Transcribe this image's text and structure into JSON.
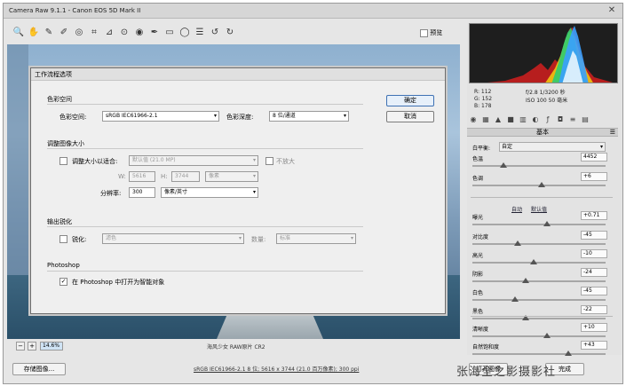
{
  "app": {
    "title": "Camera Raw 9.1.1 - Canon EOS 5D Mark II"
  },
  "toolbar": {
    "tools": [
      "zoom-icon",
      "hand-icon",
      "eyedropper-icon",
      "color-sampler-icon",
      "target-adjust-icon",
      "crop-icon",
      "straighten-icon",
      "spot-removal-icon",
      "red-eye-icon",
      "adjustment-brush-icon",
      "graduated-filter-icon",
      "radial-filter-icon",
      "preferences-icon",
      "rotate-left-icon",
      "rotate-right-icon"
    ],
    "preview_label": "预览"
  },
  "status": {
    "zoom": "14.6%",
    "filename": "海风少女 RAW原片 CR2"
  },
  "bottom": {
    "save_label": "存储图像...",
    "workflow_link": "sRGB IEC61966-2.1 8 位; 5616 x 3744 (21.0 百万像素); 300 ppi",
    "open_label": "打开图像",
    "done_label": "完成",
    "watermark": "张海全之影摄影社"
  },
  "readout": {
    "r": "R: 112",
    "g": "G: 152",
    "b": "B: 178",
    "aperture": "f/2.8  1/3200 秒",
    "iso": "ISO 100  50 毫米"
  },
  "panel": {
    "section_title": "基本",
    "wb_label": "白平衡:",
    "wb_value": "自定",
    "auto_label": "自动",
    "default_label": "默认值",
    "sliders": [
      {
        "label": "色温",
        "value": "4452",
        "pos": 0.23
      },
      {
        "label": "色调",
        "value": "+6",
        "pos": 0.52
      },
      {
        "label": "曝光",
        "value": "+0.71",
        "pos": 0.56
      },
      {
        "label": "对比度",
        "value": "-45",
        "pos": 0.34
      },
      {
        "label": "高光",
        "value": "-10",
        "pos": 0.46
      },
      {
        "label": "阴影",
        "value": "-24",
        "pos": 0.4
      },
      {
        "label": "白色",
        "value": "-45",
        "pos": 0.32
      },
      {
        "label": "黑色",
        "value": "-22",
        "pos": 0.4
      },
      {
        "label": "清晰度",
        "value": "+10",
        "pos": 0.56
      },
      {
        "label": "自然饱和度",
        "value": "+43",
        "pos": 0.72
      }
    ]
  },
  "dialog": {
    "title": "工作流程选项",
    "ok": "确定",
    "cancel": "取消",
    "color_space": {
      "group": "色彩空间",
      "space_label": "色彩空间:",
      "space_value": "sRGB IEC61966-2.1",
      "depth_label": "色彩深度:",
      "depth_value": "8 位/通道"
    },
    "resize": {
      "group": "调整图像大小",
      "fit_label": "调整大小以适合:",
      "fit_value": "默认值 (21.0 MP)",
      "no_enlarge": "不放大",
      "w_label": "W:",
      "w_value": "5616",
      "h_label": "H:",
      "h_value": "3744",
      "unit": "像素",
      "res_label": "分辨率:",
      "res_value": "300",
      "res_unit": "像素/英寸"
    },
    "sharpen": {
      "group": "输出锐化",
      "label": "锐化:",
      "value": "滤色",
      "amount_label": "数量:",
      "amount_value": "标准"
    },
    "photoshop": {
      "group": "Photoshop",
      "smart_object": "在 Photoshop 中打开为智能对象"
    }
  }
}
